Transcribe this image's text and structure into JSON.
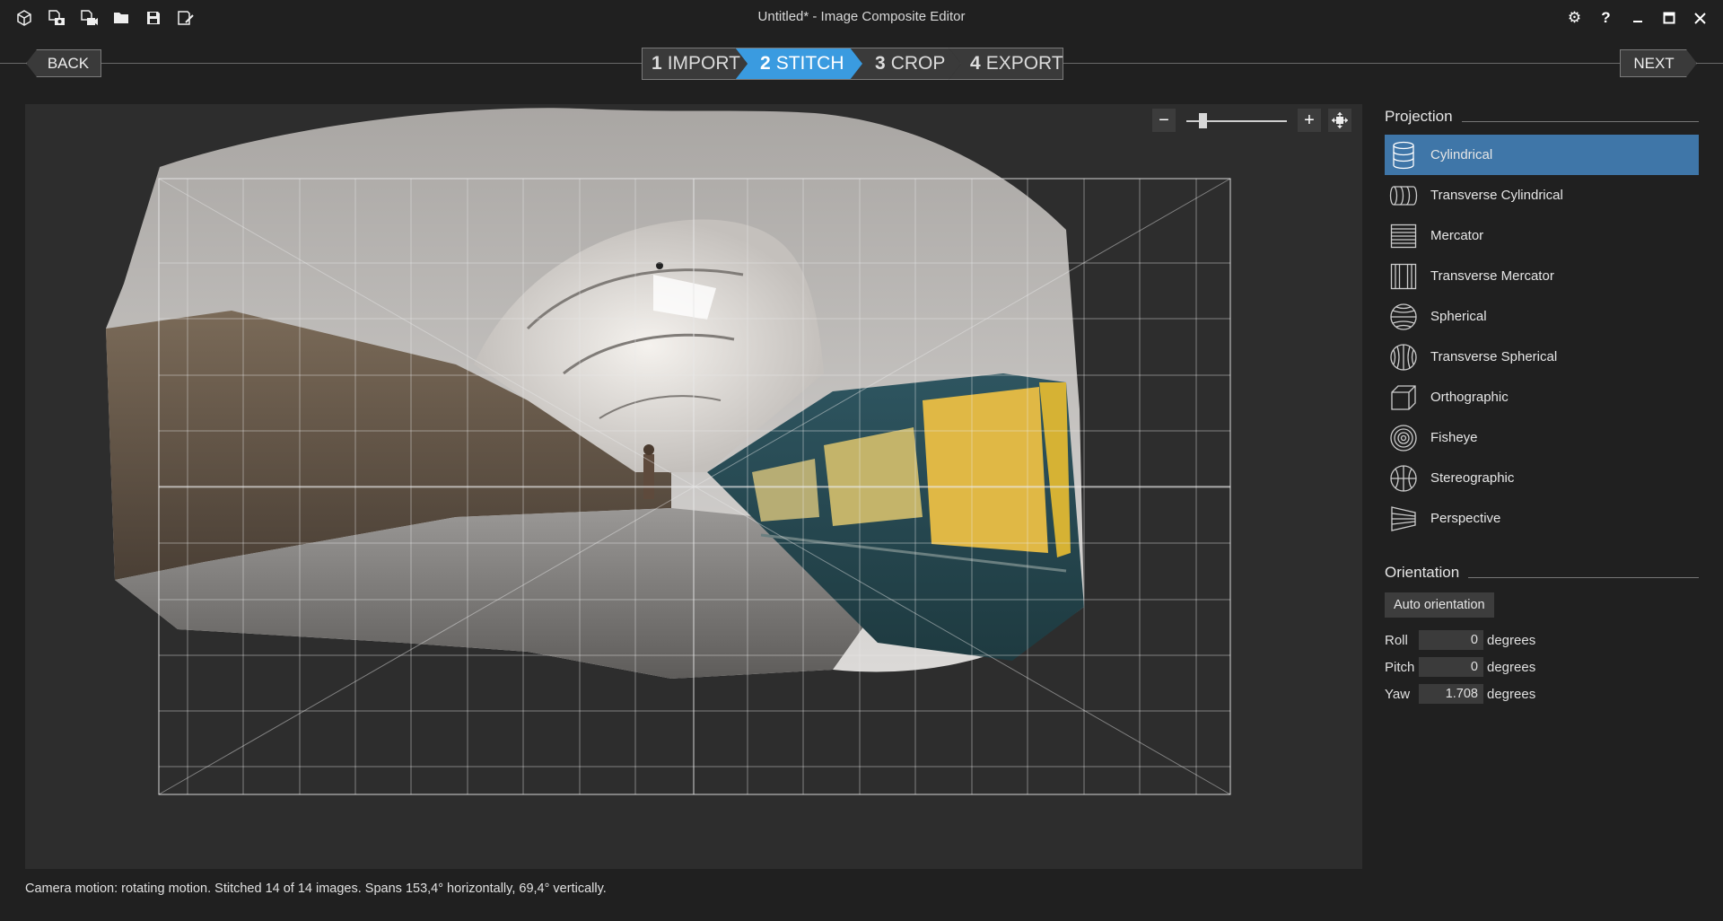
{
  "window": {
    "title": "Untitled* - Image Composite Editor",
    "toolbar_icons": [
      "new-panorama-icon",
      "new-from-images-icon",
      "new-from-video-icon",
      "open-folder-icon",
      "save-icon",
      "save-as-icon"
    ],
    "controls": [
      "settings-icon",
      "help-icon",
      "minimize-icon",
      "maximize-icon",
      "close-icon"
    ]
  },
  "nav": {
    "back_label": "BACK",
    "next_label": "NEXT",
    "steps": [
      {
        "num": "1",
        "label": "IMPORT"
      },
      {
        "num": "2",
        "label": "STITCH"
      },
      {
        "num": "3",
        "label": "CROP"
      },
      {
        "num": "4",
        "label": "EXPORT"
      }
    ],
    "active_step": 2
  },
  "status_text": "Camera motion: rotating motion. Stitched 14 of 14 images. Spans 153,4° horizontally, 69,4° vertically.",
  "projection": {
    "heading": "Projection",
    "items": [
      {
        "label": "Cylindrical",
        "icon": "cylindrical-icon",
        "selected": true
      },
      {
        "label": "Transverse Cylindrical",
        "icon": "transverse-cylindrical-icon",
        "selected": false
      },
      {
        "label": "Mercator",
        "icon": "mercator-icon",
        "selected": false
      },
      {
        "label": "Transverse Mercator",
        "icon": "transverse-mercator-icon",
        "selected": false
      },
      {
        "label": "Spherical",
        "icon": "spherical-icon",
        "selected": false
      },
      {
        "label": "Transverse Spherical",
        "icon": "transverse-spherical-icon",
        "selected": false
      },
      {
        "label": "Orthographic",
        "icon": "orthographic-icon",
        "selected": false
      },
      {
        "label": "Fisheye",
        "icon": "fisheye-icon",
        "selected": false
      },
      {
        "label": "Stereographic",
        "icon": "stereographic-icon",
        "selected": false
      },
      {
        "label": "Perspective",
        "icon": "perspective-icon",
        "selected": false
      }
    ]
  },
  "orientation": {
    "heading": "Orientation",
    "auto_label": "Auto orientation",
    "fields": [
      {
        "label": "Roll",
        "value": "0",
        "unit": "degrees"
      },
      {
        "label": "Pitch",
        "value": "0",
        "unit": "degrees"
      },
      {
        "label": "Yaw",
        "value": "1.708",
        "unit": "degrees"
      }
    ]
  },
  "colors": {
    "accent": "#3a9be0",
    "selection": "#3f76a8"
  }
}
